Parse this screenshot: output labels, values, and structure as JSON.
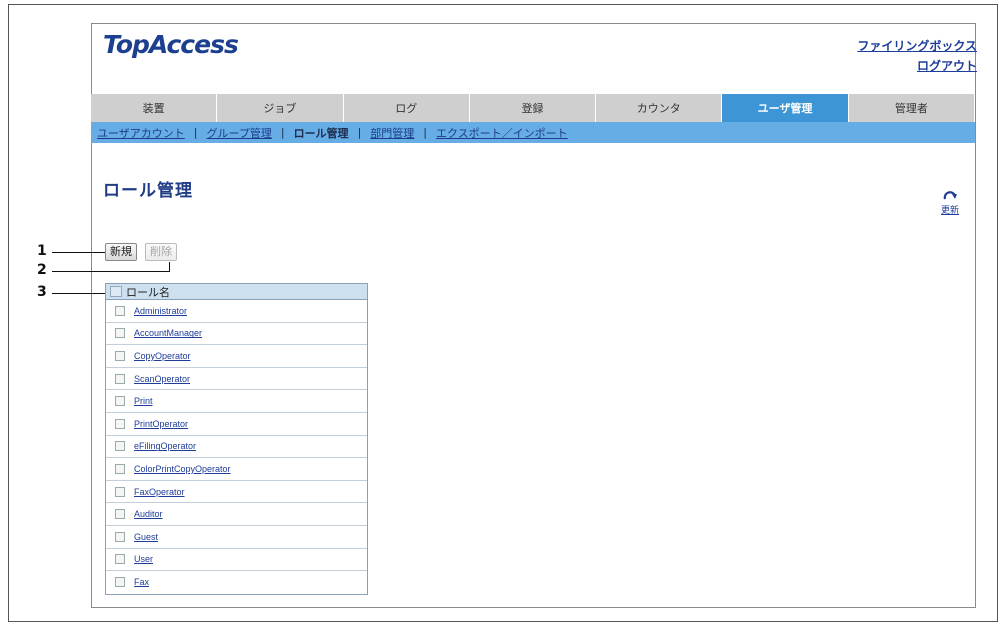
{
  "app": {
    "logo": "TopAccess"
  },
  "top_links": {
    "filing_box": "ファイリングボックス",
    "logout": "ログアウト"
  },
  "tabs": [
    {
      "label": "装置"
    },
    {
      "label": "ジョブ"
    },
    {
      "label": "ログ"
    },
    {
      "label": "登録"
    },
    {
      "label": "カウンタ"
    },
    {
      "label": "ユーザ管理",
      "active": true
    },
    {
      "label": "管理者"
    }
  ],
  "subnav": {
    "items": [
      "ユーザアカウント",
      "グループ管理",
      "ロール管理",
      "部門管理",
      "エクスポート／インポート"
    ],
    "separator": "|",
    "current": "ロール管理"
  },
  "page": {
    "title": "ロール管理"
  },
  "refresh": {
    "label": "更新"
  },
  "buttons": {
    "new_label": "新規",
    "delete_label": "削除"
  },
  "callouts": [
    "1",
    "2",
    "3"
  ],
  "table": {
    "header": "ロール名",
    "rows": [
      "Administrator",
      "AccountManager",
      "CopyOperator",
      "ScanOperator",
      "Print",
      "PrintOperator",
      "eFilingOperator",
      "ColorPrintCopyOperator",
      "FaxOperator",
      "Auditor",
      "Guest",
      "User",
      "Fax"
    ]
  },
  "colors": {
    "active_tab": "#3d95d6",
    "subnav_bg": "#66ade5",
    "link": "#1e3c99",
    "title": "#1f3c85"
  }
}
